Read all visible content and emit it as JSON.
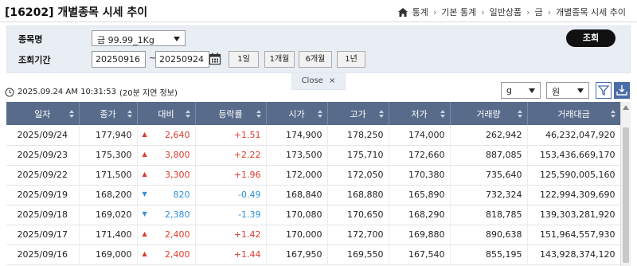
{
  "header": {
    "title": "[16202] 개별종목 시세 추이",
    "breadcrumb": [
      "통계",
      "기본 통계",
      "일반상품",
      "금",
      "개별종목 시세 추이"
    ]
  },
  "search": {
    "item_label": "종목명",
    "item_value": "금 99.99_1Kg",
    "period_label": "조회기간",
    "date_from": "20250916",
    "date_sep": "~",
    "date_to": "20250924",
    "periods": [
      "1일",
      "1개월",
      "6개월",
      "1년"
    ],
    "search_button": "조회",
    "close_label": "Close"
  },
  "toolbar": {
    "timestamp": "2025.09.24 AM 10:31:53",
    "delay_note": "(20분 지연 정보)",
    "unit_weight": "g",
    "unit_currency": "원"
  },
  "table": {
    "columns": [
      "일자",
      "종가",
      "대비",
      "등락률",
      "시가",
      "고가",
      "저가",
      "거래량",
      "거래대금"
    ],
    "rows": [
      {
        "date": "2025/09/24",
        "close": "177,940",
        "dir": "up",
        "change": "2,640",
        "rate": "+1.51",
        "open": "174,900",
        "high": "178,250",
        "low": "174,000",
        "volume": "262,942",
        "amount": "46,232,047,920"
      },
      {
        "date": "2025/09/23",
        "close": "175,300",
        "dir": "up",
        "change": "3,800",
        "rate": "+2.22",
        "open": "173,500",
        "high": "175,710",
        "low": "172,660",
        "volume": "887,085",
        "amount": "153,436,669,170"
      },
      {
        "date": "2025/09/22",
        "close": "171,500",
        "dir": "up",
        "change": "3,300",
        "rate": "+1.96",
        "open": "172,000",
        "high": "172,050",
        "low": "170,380",
        "volume": "735,640",
        "amount": "125,590,005,160"
      },
      {
        "date": "2025/09/19",
        "close": "168,200",
        "dir": "down",
        "change": "820",
        "rate": "-0.49",
        "open": "168,840",
        "high": "168,880",
        "low": "165,890",
        "volume": "732,324",
        "amount": "122,994,309,690"
      },
      {
        "date": "2025/09/18",
        "close": "169,020",
        "dir": "down",
        "change": "2,380",
        "rate": "-1.39",
        "open": "170,080",
        "high": "170,650",
        "low": "168,290",
        "volume": "818,785",
        "amount": "139,303,281,920"
      },
      {
        "date": "2025/09/17",
        "close": "171,400",
        "dir": "up",
        "change": "2,400",
        "rate": "+1.42",
        "open": "170,000",
        "high": "172,700",
        "low": "169,880",
        "volume": "890,638",
        "amount": "151,964,557,930"
      },
      {
        "date": "2025/09/16",
        "close": "169,000",
        "dir": "up",
        "change": "2,400",
        "rate": "+1.44",
        "open": "167,950",
        "high": "169,550",
        "low": "167,540",
        "volume": "855,195",
        "amount": "143,928,374,120"
      }
    ]
  },
  "colors": {
    "header_bg": "#586b8a",
    "up": "#e03a2c",
    "down": "#2e8fd8",
    "panel_bg": "#e9eef5"
  }
}
